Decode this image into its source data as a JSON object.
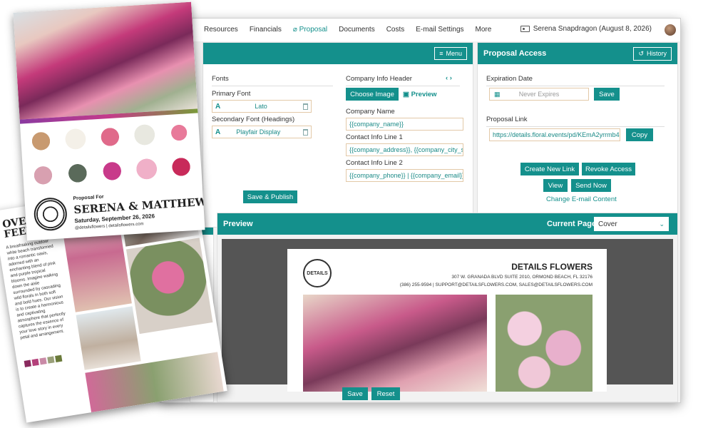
{
  "nav": {
    "items": [
      "Resources",
      "Financials",
      "Proposal",
      "Documents",
      "Costs",
      "E-mail Settings",
      "More"
    ],
    "active_index": 2,
    "user": "Serena Snapdragon (August 8, 2026)"
  },
  "settings": {
    "menu_label": "Menu",
    "fonts_heading": "Fonts",
    "primary_font_label": "Primary Font",
    "primary_font_value": "Lato",
    "secondary_font_label": "Secondary Font (Headings)",
    "secondary_font_value": "Playfair Display",
    "font_icon": "A",
    "company_header_label": "Company Info Header",
    "choose_image_label": "Choose Image",
    "preview_label": "Preview",
    "company_name_label": "Company Name",
    "company_name_value": "{{company_name}}",
    "contact1_label": "Contact Info Line 1",
    "contact1_value": "{{company_address}}, {{company_city_stat",
    "contact2_label": "Contact Info Line 2",
    "contact2_value": "{{company_phone}} | {{company_email}}",
    "save_publish_label": "Save & Publish"
  },
  "access": {
    "title": "Proposal Access",
    "history_label": "History",
    "expiration_label": "Expiration Date",
    "expiration_placeholder": "Never Expires",
    "save_label": "Save",
    "link_label": "Proposal Link",
    "link_value": "https://details.floral.events/pd/KEmA2yrrmb4",
    "copy_label": "Copy",
    "create_link_label": "Create New Link",
    "revoke_label": "Revoke Access",
    "view_label": "View",
    "send_now_label": "Send Now",
    "change_email_label": "Change E-mail Content"
  },
  "preview": {
    "title": "Preview",
    "current_page_label": "Current Page:",
    "current_page_value": "Cover",
    "save_label": "Save",
    "reset_label": "Reset",
    "doc_company": "DETAILS FLOWERS",
    "doc_address": "307 W. GRANADA BLVD SUITE 2010, ORMOND BEACH, FL 32176",
    "doc_contact": "(386) 255-9594 | SUPPORT@DETAILSFLOWERS.COM, SALES@DETAILSFLOWERS.COM",
    "doc_logo": "DETAILS"
  },
  "brochure_front": {
    "proposal_for": "Proposal For",
    "couple": "SERENA & MATTHEW",
    "date": "Saturday, September 26, 2026",
    "handle": "@detailsflowers | detailsflowers.com"
  },
  "brochure_back": {
    "heading": "OVERALL FEELING:",
    "body": "A breathtaking outdoor white beach transformed into a romantic oasis, adorned with an enchanting blend of pink and purple tropical blooms. Imagine walking down the aisle surrounded by cascading wild florals in both soft and bold hues. Our vision is to create a harmonious and captivating atmosphere that perfectly captures the essence of your love story in every petal and arrangement."
  },
  "colors": {
    "accent": "#14908c",
    "swatches": [
      "#8a2a5e",
      "#b4407a",
      "#c98aa6",
      "#9aa07a",
      "#6a7a3a"
    ]
  }
}
